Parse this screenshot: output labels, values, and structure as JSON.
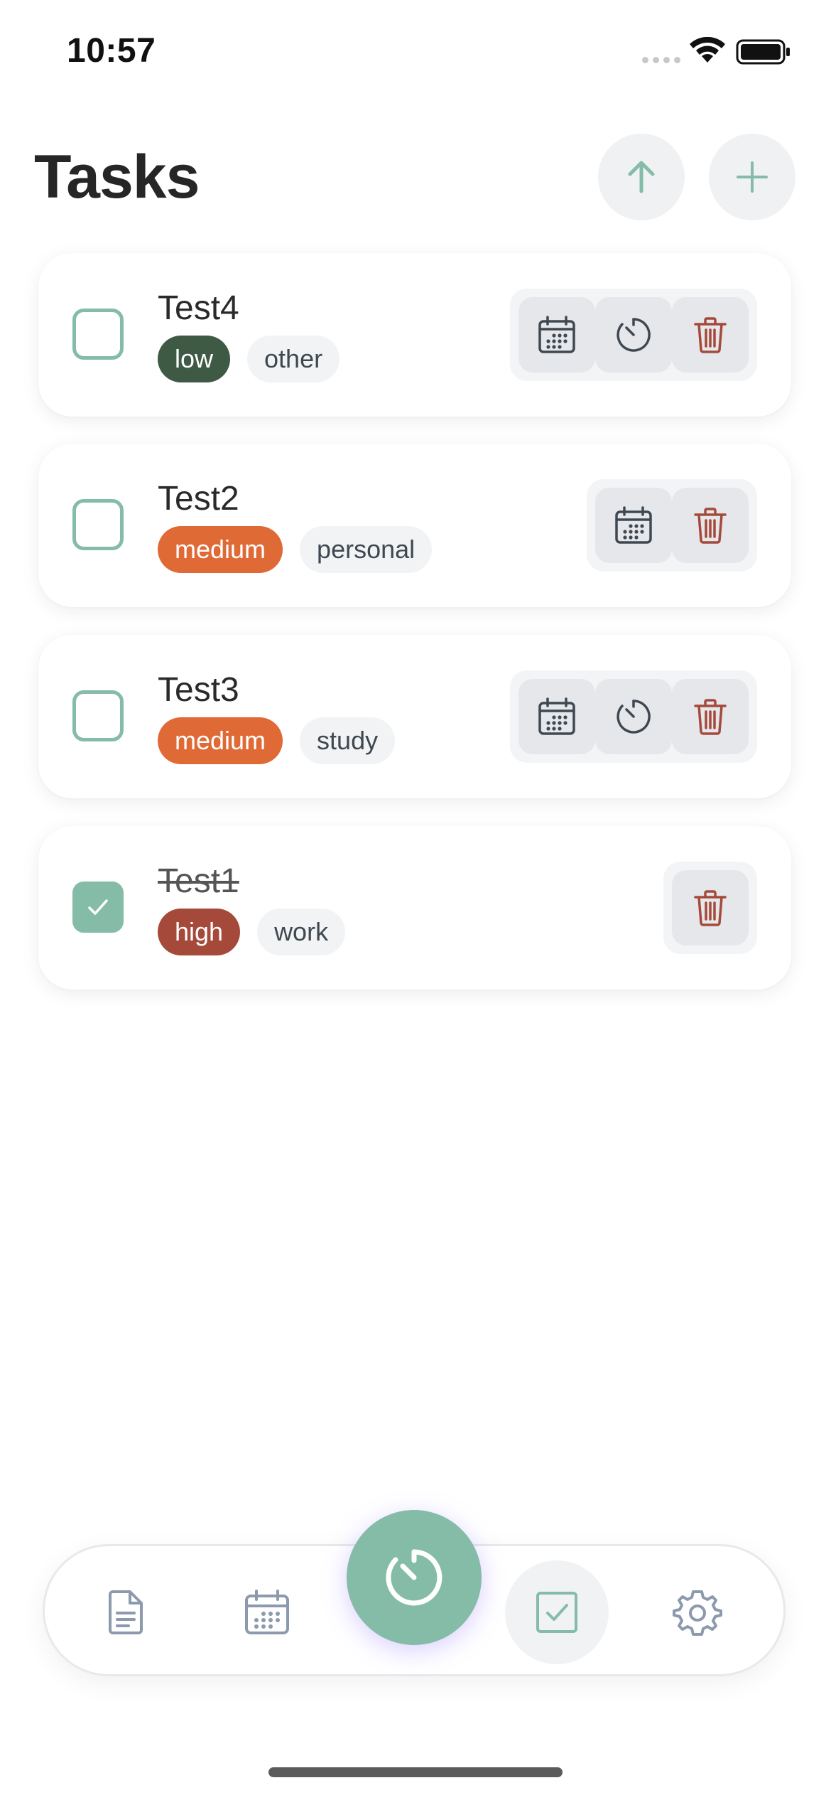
{
  "status_bar": {
    "time": "10:57",
    "icons": [
      "signal-icon",
      "wifi-icon",
      "battery-icon"
    ]
  },
  "header": {
    "title": "Tasks",
    "buttons": [
      {
        "icon": "arrow-up-icon",
        "color": "#85bca8"
      },
      {
        "icon": "plus-icon",
        "color": "#85bca8"
      }
    ]
  },
  "tasks": [
    {
      "title": "Test4",
      "completed": false,
      "priority": "low",
      "category": "other",
      "actions": [
        "calendar-icon",
        "timer-icon",
        "trash-icon"
      ]
    },
    {
      "title": "Test2",
      "completed": false,
      "priority": "medium",
      "category": "personal",
      "actions": [
        "calendar-icon",
        "trash-icon"
      ]
    },
    {
      "title": "Test3",
      "completed": false,
      "priority": "medium",
      "category": "study",
      "actions": [
        "calendar-icon",
        "timer-icon",
        "trash-icon"
      ]
    },
    {
      "title": "Test1",
      "completed": true,
      "priority": "high",
      "category": "work",
      "actions": [
        "trash-icon"
      ]
    }
  ],
  "colors": {
    "accent": "#85bca8",
    "priority_low": "#3e5a44",
    "priority_medium": "#df6a36",
    "priority_high": "#a54a3a",
    "delete": "#a54a3a",
    "nav_icon": "#8d9aad"
  },
  "bottom_nav": {
    "items": [
      "document-icon",
      "calendar-icon",
      "timer-icon",
      "checkbox-icon",
      "gear-icon"
    ],
    "active": "checkbox-icon",
    "center": "timer-icon"
  }
}
